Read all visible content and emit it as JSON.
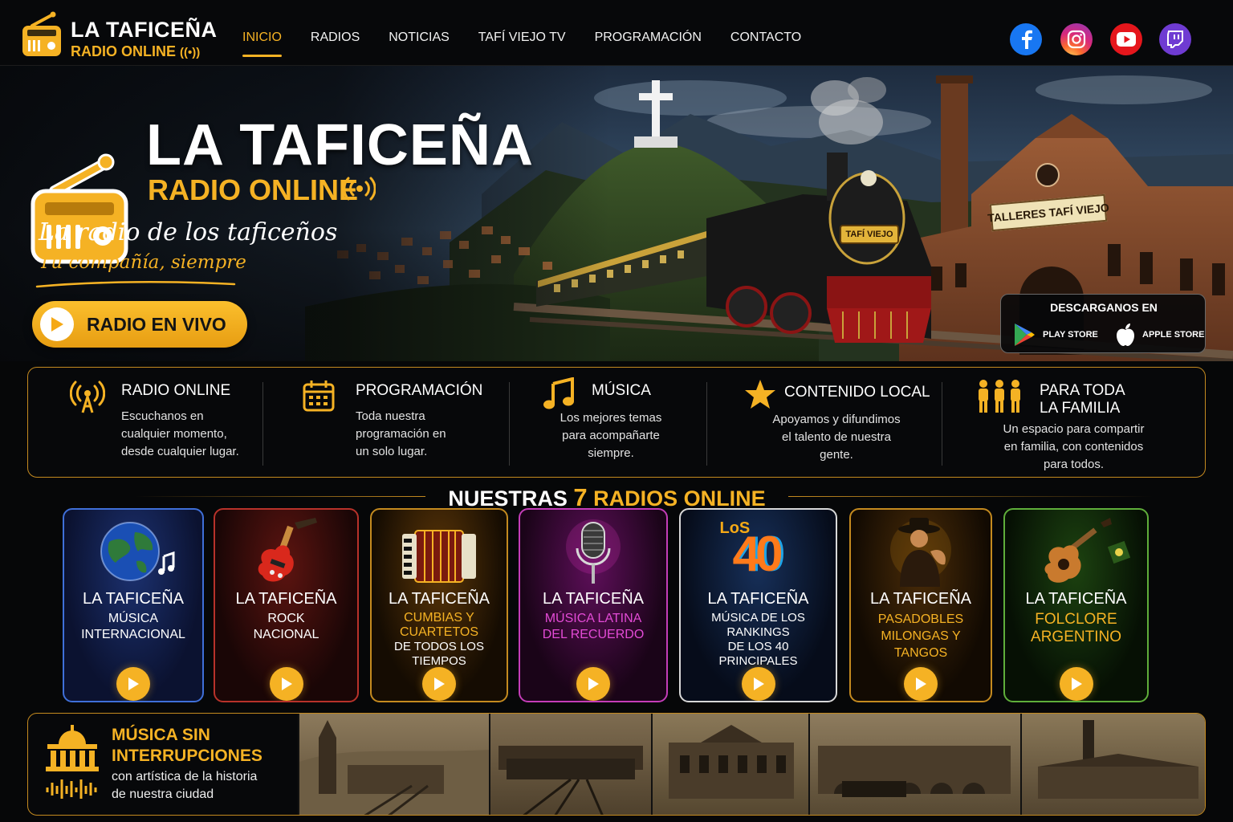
{
  "nav": {
    "brand": "LA TAFICEÑA",
    "brand_sub": "RADIO ONLINE",
    "items": [
      {
        "label": "INICIO",
        "active": true
      },
      {
        "label": "RADIOS"
      },
      {
        "label": "NOTICIAS"
      },
      {
        "label": "TAFÍ VIEJO TV"
      },
      {
        "label": "PROGRAMACIÓN"
      },
      {
        "label": "CONTACTO"
      }
    ],
    "social": [
      "facebook-icon",
      "instagram-icon",
      "youtube-icon",
      "twitch-icon"
    ]
  },
  "hero": {
    "title": "LA TAFICEÑA",
    "subtitle": "RADIO ONLINE",
    "tagline": "La radio de los taficeños",
    "tagline2": "Tu compañía, siempre",
    "live_button": "RADIO EN VIVO",
    "sign_text": "TALLERES TAFÍ VIEJO",
    "locomotive_plate": "TAFÍ VIEJO",
    "download": {
      "title": "DESCARGANOS EN",
      "play_store": "PLAY STORE",
      "apple_store": "APPLE STORE"
    }
  },
  "features": [
    {
      "icon": "antenna-icon",
      "title": "RADIO ONLINE",
      "desc": [
        "Escuchanos en",
        "cualquier momento,",
        "desde cualquier lugar."
      ]
    },
    {
      "icon": "calendar-icon",
      "title": "PROGRAMACIÓN",
      "desc": [
        "Toda nuestra",
        "programación en",
        "un solo lugar."
      ]
    },
    {
      "icon": "music-note-icon",
      "title": "MÚSICA",
      "desc": [
        "Los mejores temas",
        "para acompañarte",
        "siempre."
      ]
    },
    {
      "icon": "star-icon",
      "title": "CONTENIDO LOCAL",
      "desc": [
        "Apoyamos y difundimos",
        "el talento de nuestra",
        "gente."
      ]
    },
    {
      "icon": "family-icon",
      "title": "PARA TODA\nLA FAMILIA",
      "desc": [
        "Un espacio para compartir",
        "en familia, con contenidos",
        "para todos."
      ]
    }
  ],
  "radios_section": {
    "title_prefix": "NUESTRAS",
    "count": "7",
    "title_suffix": "RADIOS ONLINE"
  },
  "radios": [
    {
      "name": "LA TAFICEÑA",
      "genre": "MÚSICA\nINTERNACIONAL",
      "genre_color": "#ffffff",
      "icon": "globe-icon",
      "border": "#3f6fd8"
    },
    {
      "name": "LA TAFICEÑA",
      "genre": "ROCK\nNACIONAL",
      "genre_color": "#ffffff",
      "icon": "electric-guitar-icon",
      "border": "#b8322a"
    },
    {
      "name": "LA TAFICEÑA",
      "genre": "CUMBIAS Y\nCUARTETOS",
      "genre_extra": "DE TODOS LOS\nTIEMPOS",
      "genre_color": "#f5b224",
      "icon": "accordion-icon",
      "border": "#c48a1f"
    },
    {
      "name": "LA TAFICEÑA",
      "genre": "MÚSICA LATINA\nDEL RECUERDO",
      "genre_color": "#e34bd6",
      "icon": "microphone-icon",
      "border": "#c43db8"
    },
    {
      "name": "LA TAFICEÑA",
      "genre": "MÚSICA DE LOS\nRANKINGS\nDE LOS 40\nPRINCIPALES",
      "genre_color": "#ffffff",
      "icon": "los40-logo-icon",
      "logo_text": "LoS",
      "logo_num": "40",
      "border": "#d8d8d8"
    },
    {
      "name": "LA TAFICEÑA",
      "genre": "PASADOBLES\nMILONGAS Y\nTANGOS",
      "genre_color": "#f5b224",
      "icon": "tango-dancers-icon",
      "border": "#c48a1f"
    },
    {
      "name": "LA TAFICEÑA",
      "genre": "FOLCLORE\nARGENTINO",
      "genre_color": "#f5b224",
      "icon": "acoustic-guitar-icon",
      "border": "#5fae3a"
    }
  ],
  "bottom": {
    "title": "MÚSICA SIN\nINTERRUPCIONES",
    "desc": "con artística de la historia\nde nuestra ciudad"
  },
  "colors": {
    "accent": "#f5b224",
    "background": "#060708",
    "border": "#c48a1f"
  }
}
